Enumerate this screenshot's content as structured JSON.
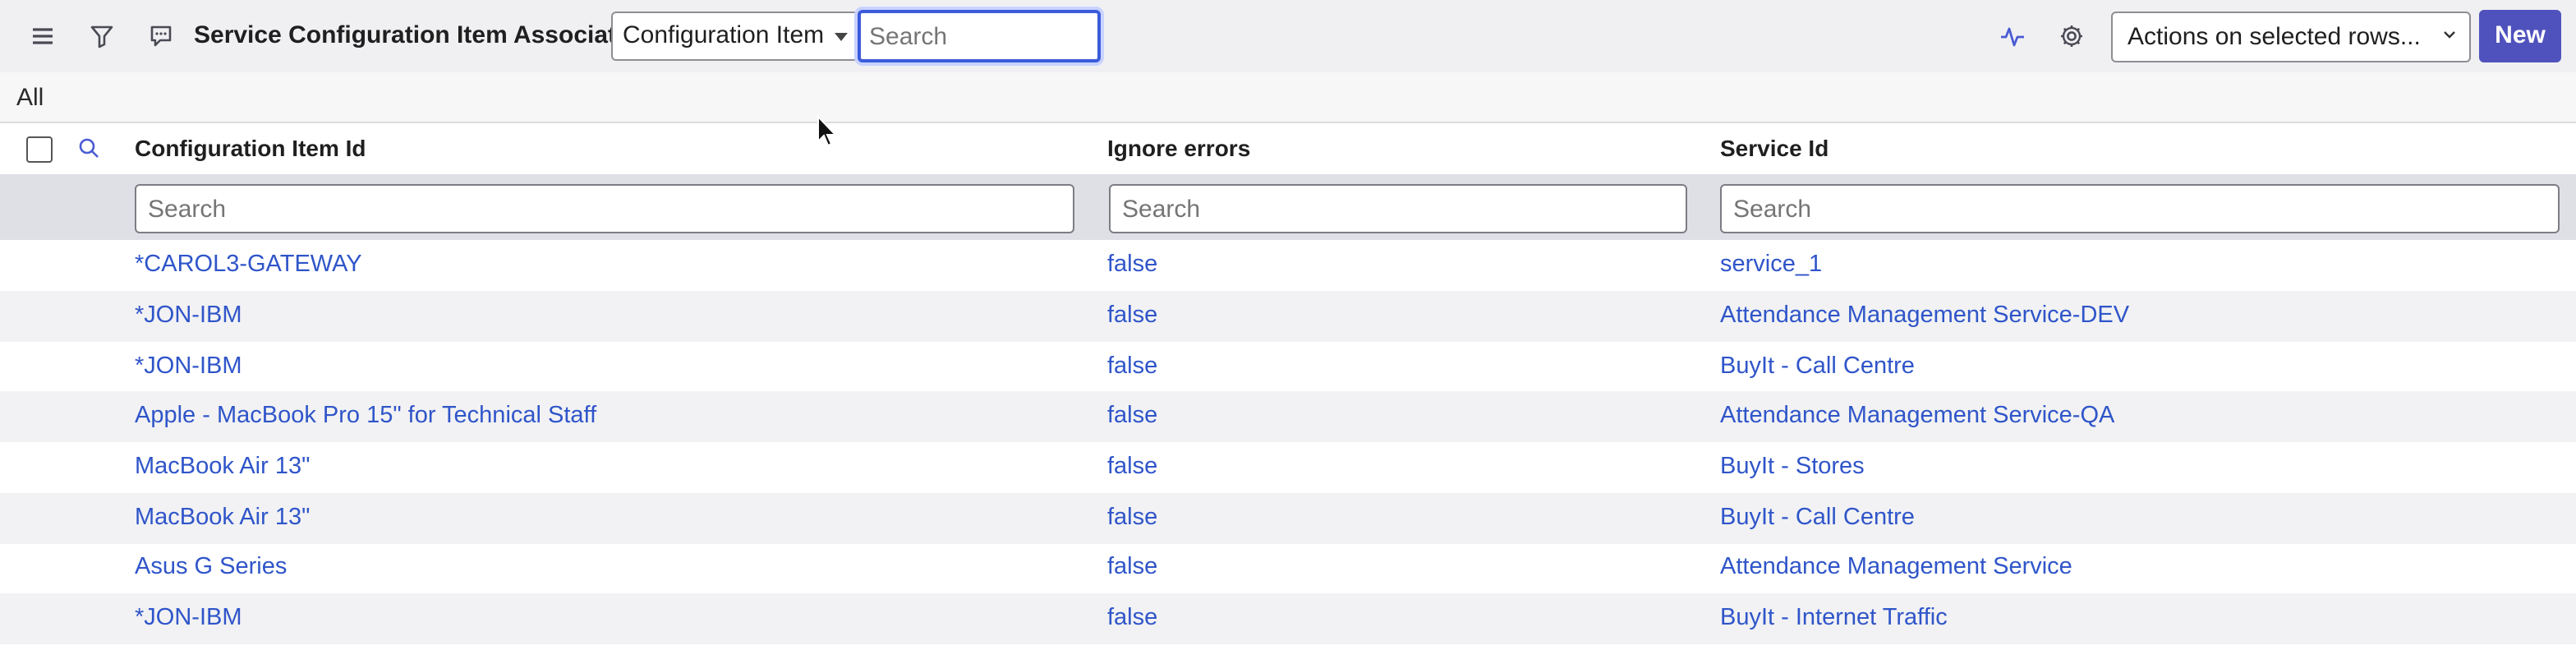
{
  "header": {
    "title": "Service Configuration Item Associations",
    "field_selected": "Configuration Item I",
    "search_placeholder": "Search",
    "actions_label": "Actions on selected rows...",
    "new_label": "New",
    "icons": [
      "menu-icon",
      "filter-icon",
      "chat-icon",
      "pulse-icon",
      "gear-icon"
    ]
  },
  "breadcrumb": {
    "label": "All"
  },
  "columns": [
    {
      "label": "Configuration Item Id",
      "search_placeholder": "Search"
    },
    {
      "label": "Ignore errors",
      "search_placeholder": "Search"
    },
    {
      "label": "Service Id",
      "search_placeholder": "Search"
    }
  ],
  "rows": [
    {
      "ci": "*CAROL3-GATEWAY",
      "ignore": "false",
      "service": "service_1"
    },
    {
      "ci": "*JON-IBM",
      "ignore": "false",
      "service": "Attendance Management Service-DEV"
    },
    {
      "ci": "*JON-IBM",
      "ignore": "false",
      "service": "BuyIt - Call Centre"
    },
    {
      "ci": "Apple - MacBook Pro 15\" for Technical Staff",
      "ignore": "false",
      "service": "Attendance Management Service-QA"
    },
    {
      "ci": "MacBook Air 13\"",
      "ignore": "false",
      "service": "BuyIt - Stores"
    },
    {
      "ci": "MacBook Air 13\"",
      "ignore": "false",
      "service": "BuyIt - Call Centre"
    },
    {
      "ci": "Asus G Series",
      "ignore": "false",
      "service": "Attendance Management Service"
    },
    {
      "ci": "*JON-IBM",
      "ignore": "false",
      "service": "BuyIt - Internet Traffic"
    }
  ],
  "colors": {
    "accent": "#4f52bd",
    "link": "#2f55c9",
    "header_bg": "#f0f0f3"
  }
}
